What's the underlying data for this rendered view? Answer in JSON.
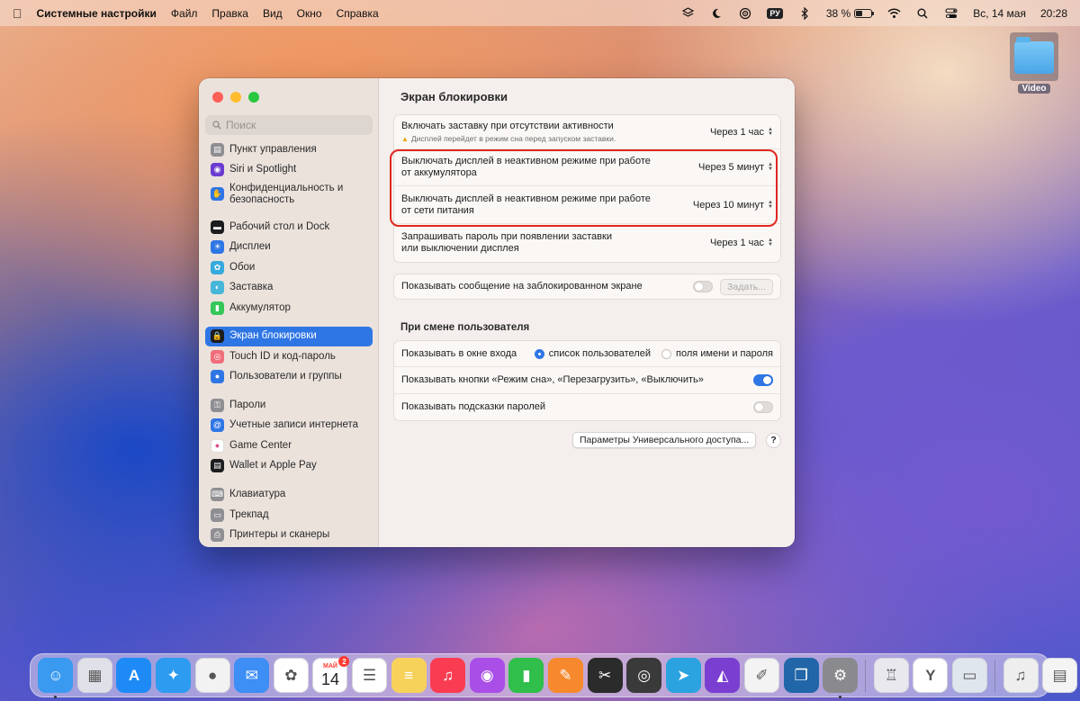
{
  "menubar": {
    "app_name": "Системные настройки",
    "items": [
      "Файл",
      "Правка",
      "Вид",
      "Окно",
      "Справка"
    ],
    "input_source": "РУ",
    "battery_percent": "38 %",
    "battery_level": 0.38,
    "date": "Вс, 14 мая",
    "time": "20:28"
  },
  "desktop": {
    "folder_label": "Video"
  },
  "sidebar": {
    "search_placeholder": "Поиск",
    "items": [
      {
        "label": "Пункт управления",
        "icon": "control-center-icon",
        "color": "#8e8e93"
      },
      {
        "label": "Siri и Spotlight",
        "icon": "siri-icon",
        "color": "#6c3bd1"
      },
      {
        "label": "Конфиденциальность и безопасность",
        "icon": "privacy-hand-icon",
        "color": "#2f76e5"
      },
      {
        "label": "Рабочий стол и Dock",
        "icon": "desktop-dock-icon",
        "color": "#1c1c1e"
      },
      {
        "label": "Дисплеи",
        "icon": "displays-icon",
        "color": "#2f76e5"
      },
      {
        "label": "Обои",
        "icon": "wallpaper-icon",
        "color": "#35aadc"
      },
      {
        "label": "Заставка",
        "icon": "screensaver-icon",
        "color": "#46b6d9"
      },
      {
        "label": "Аккумулятор",
        "icon": "battery-icon",
        "color": "#34c759"
      },
      {
        "label": "Экран блокировки",
        "icon": "lock-screen-icon",
        "color": "#1c1c1e"
      },
      {
        "label": "Touch ID и код-пароль",
        "icon": "fingerprint-icon",
        "color": "#f06d7a"
      },
      {
        "label": "Пользователи и группы",
        "icon": "users-icon",
        "color": "#2f76e5"
      },
      {
        "label": "Пароли",
        "icon": "key-icon",
        "color": "#8e8e93"
      },
      {
        "label": "Учетные записи интернета",
        "icon": "at-icon",
        "color": "#2f76e5"
      },
      {
        "label": "Game Center",
        "icon": "game-center-icon",
        "color": "#ffffff"
      },
      {
        "label": "Wallet и Apple Pay",
        "icon": "wallet-icon",
        "color": "#1c1c1e"
      },
      {
        "label": "Клавиатура",
        "icon": "keyboard-icon",
        "color": "#8e8e93"
      },
      {
        "label": "Трекпад",
        "icon": "trackpad-icon",
        "color": "#8e8e93"
      },
      {
        "label": "Принтеры и сканеры",
        "icon": "printer-icon",
        "color": "#8e8e93"
      }
    ]
  },
  "content": {
    "title": "Экран блокировки",
    "screensaver": {
      "label": "Включать заставку при отсутствии активности",
      "warning": "Дисплей перейдет в режим сна перед запуском заставки.",
      "value": "Через 1 час"
    },
    "display_battery": {
      "label_line1": "Выключать дисплей в неактивном режиме при работе",
      "label_line2": "от аккумулятора",
      "value": "Через 5 минут"
    },
    "display_power": {
      "label_line1": "Выключать дисплей в неактивном режиме при работе",
      "label_line2": "от сети питания",
      "value": "Через 10 минут"
    },
    "require_password": {
      "label_line1": "Запрашивать пароль при появлении заставки",
      "label_line2": "или выключении дисплея",
      "value": "Через 1 час"
    },
    "lock_message": {
      "label": "Показывать сообщение на заблокированном экране",
      "button": "Задать...",
      "enabled": false
    },
    "user_switch": {
      "section_title": "При смене пользователя",
      "login_window_label": "Показывать в окне входа",
      "option_users": "список пользователей",
      "option_fields": "поля имени и пароля",
      "show_buttons_label": "Показывать кнопки «Режим сна», «Перезагрузить», «Выключить»",
      "show_buttons_enabled": true,
      "hints_label": "Показывать подсказки паролей",
      "hints_enabled": false
    },
    "accessibility_button": "Параметры Универсального доступа...",
    "help_button": "?"
  },
  "dock": {
    "calendar_month": "МАЙ",
    "calendar_day": "14",
    "calendar_badge": "2",
    "apps": [
      {
        "name": "finder-icon",
        "color": "#3a9af0",
        "glyph": "☺",
        "running": true
      },
      {
        "name": "launchpad-icon",
        "color": "#e0e0e8",
        "glyph": "▦",
        "running": false
      },
      {
        "name": "app-store-icon",
        "color": "#1e8af5",
        "glyph": "A",
        "running": false
      },
      {
        "name": "safari-icon",
        "color": "#2d9cf0",
        "glyph": "✦",
        "running": false
      },
      {
        "name": "chrome-icon",
        "color": "#f2f2f2",
        "glyph": "●",
        "running": false
      },
      {
        "name": "mail-icon",
        "color": "#3d8ef5",
        "glyph": "✉",
        "running": false
      },
      {
        "name": "photos-icon",
        "color": "#ffffff",
        "glyph": "✿",
        "running": false
      },
      {
        "name": "calendar-icon",
        "color": "#ffffff",
        "glyph": "",
        "running": false
      },
      {
        "name": "reminders-icon",
        "color": "#ffffff",
        "glyph": "☰",
        "running": false
      },
      {
        "name": "notes-icon",
        "color": "#f7d25b",
        "glyph": "≡",
        "running": false
      },
      {
        "name": "music-icon",
        "color": "#fa3c52",
        "glyph": "♫",
        "running": false
      },
      {
        "name": "podcasts-icon",
        "color": "#a94ee6",
        "glyph": "◉",
        "running": false
      },
      {
        "name": "numbers-icon",
        "color": "#2fbf4a",
        "glyph": "▮",
        "running": false
      },
      {
        "name": "pages-icon",
        "color": "#f6892d",
        "glyph": "✎",
        "running": false
      },
      {
        "name": "final-cut-icon",
        "color": "#2b2b2b",
        "glyph": "✂",
        "running": false
      },
      {
        "name": "dvd-player-icon",
        "color": "#3a3a3a",
        "glyph": "◎",
        "running": false
      },
      {
        "name": "telegram-icon",
        "color": "#2aa3e0",
        "glyph": "➤",
        "running": false
      },
      {
        "name": "affinity-photo-icon",
        "color": "#7a3fd1",
        "glyph": "◭",
        "running": false
      },
      {
        "name": "affinity-designer-icon",
        "color": "#f3f3f3",
        "glyph": "✐",
        "running": false
      },
      {
        "name": "preview-icon",
        "color": "#2166a8",
        "glyph": "❐",
        "running": false
      },
      {
        "name": "system-settings-icon",
        "color": "#8a8a8e",
        "glyph": "⚙",
        "running": true
      },
      {
        "name": "automator-icon",
        "color": "#e8e8ee",
        "glyph": "♖",
        "running": false
      },
      {
        "name": "yandex-browser-icon",
        "color": "#ffffff",
        "glyph": "Y",
        "running": false
      },
      {
        "name": "screen-sharing-icon",
        "color": "#dfe6ee",
        "glyph": "▭",
        "running": false
      }
    ],
    "stack_items": [
      {
        "name": "music-file-stack-icon",
        "color": "#eeeeee",
        "glyph": "♫"
      },
      {
        "name": "downloads-stack-icon",
        "color": "#f4f4f4",
        "glyph": "▤"
      },
      {
        "name": "trash-icon",
        "color": "#d9dde2",
        "glyph": "🗑"
      }
    ]
  }
}
